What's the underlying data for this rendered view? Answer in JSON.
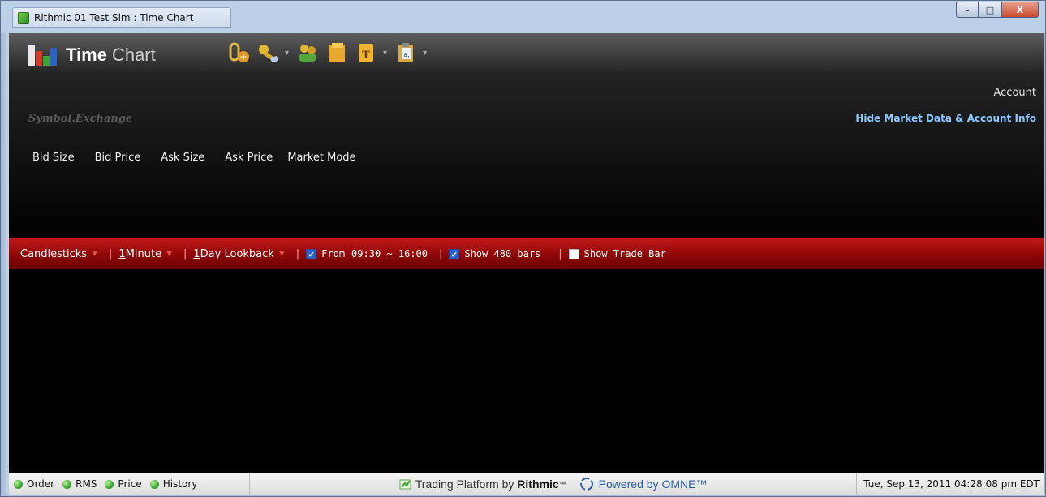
{
  "window": {
    "title": "Rithmic 01 Test Sim : Time Chart",
    "controls": {
      "minimize": "–",
      "maximize": "□",
      "close": "X"
    }
  },
  "toolbar": {
    "logo_bold": "Time",
    "logo_light": "Chart",
    "tools": [
      "attach-add-icon",
      "key-icon",
      "people-icon",
      "folder-icon",
      "template-icon",
      "clipboard-icon"
    ]
  },
  "info": {
    "account_label": "Account",
    "hide_link": "Hide Market Data & Account Info",
    "symbol_placeholder": "Symbol.Exchange",
    "columns": [
      "Bid Size",
      "Bid Price",
      "Ask Size",
      "Ask Price",
      "Market Mode"
    ]
  },
  "options": {
    "chart_type": "Candlesticks",
    "interval_num": "1",
    "interval_unit": " Minute",
    "lookback_num": "1",
    "lookback_unit": " Day Lookback",
    "from_label": "From",
    "from_range": "09:30 ~ 16:00",
    "from_checked": true,
    "show_bars_label": "Show 480 bars",
    "show_bars_checked": true,
    "trade_bar_label": "Show Trade Bar",
    "trade_bar_checked": false
  },
  "status": {
    "indicators": [
      "Order",
      "RMS",
      "Price",
      "History"
    ],
    "platform_prefix": "Trading Platform by",
    "platform_brand": "Rithmic",
    "tm": "™",
    "powered": "Powered by OMNE™",
    "datetime": "Tue, Sep 13, 2011 04:28:08 pm EDT"
  },
  "colors": {
    "options_bar": "#a00c0c",
    "link": "#8cc8ff",
    "status_dot": "#3aa530"
  }
}
